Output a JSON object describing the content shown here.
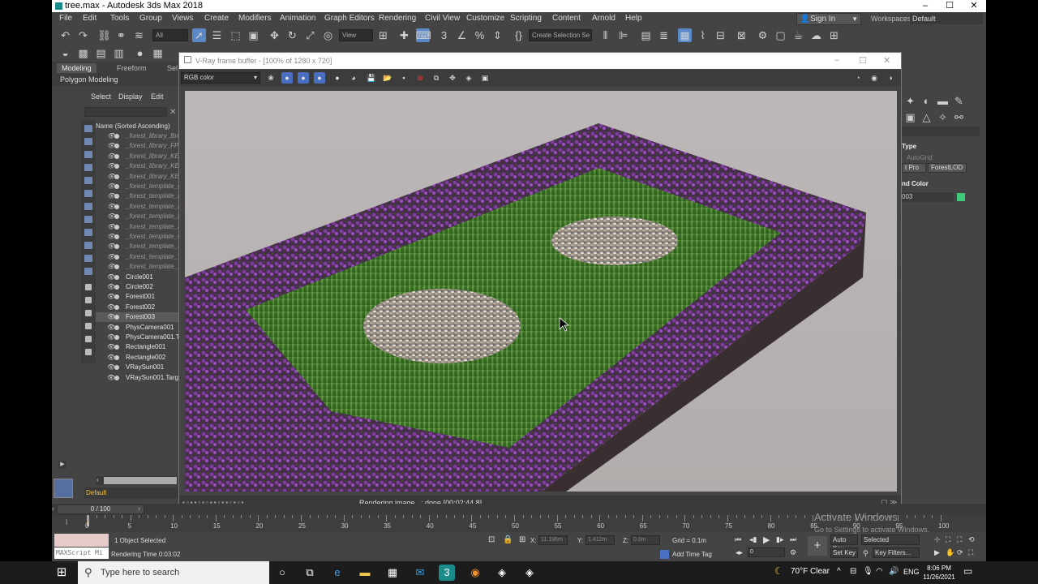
{
  "window": {
    "title": "tree.max - Autodesk 3ds Max 2018",
    "min": "–",
    "max": "☐",
    "close": "✕"
  },
  "menu": [
    "File",
    "Edit",
    "Tools",
    "Group",
    "Views",
    "Create",
    "Modifiers",
    "Animation",
    "Graph Editors",
    "Rendering",
    "Civil View",
    "Customize",
    "Scripting",
    "Content",
    "Arnold",
    "Help"
  ],
  "signin": "Sign In",
  "workspaces_label": "Workspaces:",
  "workspaces_value": "Default",
  "toolbar": {
    "filter_value": "All",
    "view_value": "View",
    "selection_set": "Create Selection Se"
  },
  "ribbon": {
    "tabs": [
      "Modeling",
      "Freeform",
      "Sel"
    ],
    "panel": "Polygon Modeling"
  },
  "explorer": {
    "tabs": [
      "Select",
      "Display",
      "Edit"
    ],
    "header": "Name (Sorted Ascending)",
    "items": [
      {
        "name": "_forest_library_Bru",
        "dim": true
      },
      {
        "name": "_forest_library_FPL",
        "dim": true
      },
      {
        "name": "_forest_library_KED",
        "dim": true
      },
      {
        "name": "_forest_library_KED",
        "dim": true
      },
      {
        "name": "_forest_library_KED",
        "dim": true
      },
      {
        "name": "_forest_template_C",
        "dim": true
      },
      {
        "name": "_forest_template_F",
        "dim": true
      },
      {
        "name": "_forest_template_H",
        "dim": true
      },
      {
        "name": "_forest_template_L",
        "dim": true
      },
      {
        "name": "_forest_template_R",
        "dim": true
      },
      {
        "name": "_forest_template_G",
        "dim": true
      },
      {
        "name": "_forest_template_S",
        "dim": true
      },
      {
        "name": "_forest_template_T",
        "dim": true
      },
      {
        "name": "_forest_template_T",
        "dim": true
      },
      {
        "name": "Circle001",
        "dim": false
      },
      {
        "name": "Circle002",
        "dim": false
      },
      {
        "name": "Forest001",
        "dim": false
      },
      {
        "name": "Forest002",
        "dim": false
      },
      {
        "name": "Forest003",
        "dim": false,
        "sel": true
      },
      {
        "name": "PhysCamera001",
        "dim": false
      },
      {
        "name": "PhysCamera001.Ta",
        "dim": false
      },
      {
        "name": "Rectangle001",
        "dim": false
      },
      {
        "name": "Rectangle002",
        "dim": false
      },
      {
        "name": "VRaySun001",
        "dim": false
      },
      {
        "name": "VRaySun001.Targe",
        "dim": false
      }
    ],
    "layer": "Default"
  },
  "vfb": {
    "title": "V-Ray frame buffer - [100% of 1280 x 720]",
    "channel": "RGB color",
    "status": "Rendering image...: done [00:02:44.8]"
  },
  "right_panel": {
    "type_header": "Type",
    "autogrid": "AutoGrid",
    "btn1": "t Pro",
    "btn2": "ForestLOD",
    "color_header": "nd Color",
    "name_val": "003",
    "swatch_color": "#3ec87a"
  },
  "time": {
    "slider": "0 / 100",
    "ticks": [
      "0",
      "5",
      "10",
      "15",
      "20",
      "25",
      "30",
      "35",
      "40",
      "45",
      "50",
      "55",
      "60",
      "65",
      "70",
      "75",
      "80",
      "85",
      "90",
      "95",
      "100"
    ]
  },
  "status": {
    "maxscript": "MAXScript Mi",
    "selected": "1 Object Selected",
    "render_time": "Rendering Time  0:03:02",
    "x_label": "X:",
    "x_val": "11.196m",
    "y_label": "Y:",
    "y_val": "1.412m",
    "z_label": "Z:",
    "z_val": "0.0m",
    "grid": "Grid = 0.1m",
    "add_time_tag": "Add Time Tag",
    "auto_key": "Auto Key",
    "set_key": "Set Key",
    "selected_dd": "Selected",
    "key_filters": "Key Filters...",
    "frame": "0"
  },
  "activation": {
    "line1": "Activate Windows",
    "line2": "Go to Settings to activate Windows."
  },
  "taskbar": {
    "search": "Type here to search",
    "weather": "70°F  Clear",
    "lang": "ENG",
    "time": "8:06 PM",
    "date": "11/26/2021"
  }
}
